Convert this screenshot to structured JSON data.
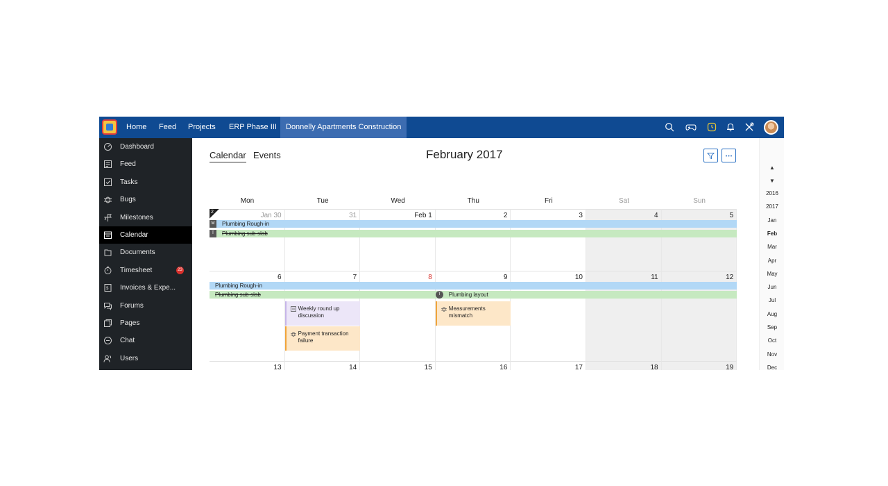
{
  "topbar": {
    "nav": [
      "Home",
      "Feed",
      "Projects",
      "ERP Phase III",
      "Donnelly Apartments Construction"
    ],
    "icons": [
      "search-icon",
      "gamepad-icon",
      "timer-icon",
      "bell-icon",
      "tools-icon"
    ],
    "accent": "#0f4a92"
  },
  "sidebar": {
    "items": [
      {
        "label": "Dashboard",
        "icon": "dashboard-icon"
      },
      {
        "label": "Feed",
        "icon": "feed-icon"
      },
      {
        "label": "Tasks",
        "icon": "tasks-icon"
      },
      {
        "label": "Bugs",
        "icon": "bug-icon"
      },
      {
        "label": "Milestones",
        "icon": "milestone-icon"
      },
      {
        "label": "Calendar",
        "icon": "calendar-icon",
        "active": true
      },
      {
        "label": "Documents",
        "icon": "documents-icon"
      },
      {
        "label": "Timesheet",
        "icon": "timer-icon",
        "badge": "23"
      },
      {
        "label": "Invoices & Expe...",
        "icon": "invoice-icon"
      },
      {
        "label": "Forums",
        "icon": "forums-icon"
      },
      {
        "label": "Pages",
        "icon": "pages-icon"
      },
      {
        "label": "Chat",
        "icon": "chat-icon"
      },
      {
        "label": "Users",
        "icon": "users-icon"
      }
    ]
  },
  "main": {
    "tabs": [
      "Calendar",
      "Events"
    ],
    "title": "February 2017",
    "weekdays": [
      "Mon",
      "Tue",
      "Wed",
      "Thu",
      "Fri",
      "Sat",
      "Sun"
    ],
    "week_marker": "2",
    "weeks": [
      {
        "days": [
          "Jan 30",
          "31",
          "Feb 1",
          "2",
          "3",
          "4",
          "5"
        ],
        "bars": [
          {
            "tag": "M",
            "label": "Plumbing Rough-in",
            "color": "blue",
            "strike": false
          },
          {
            "tag": "T",
            "label": "Plumbing sub-slab",
            "color": "green",
            "strike": true
          }
        ]
      },
      {
        "days": [
          "6",
          "7",
          "8",
          "9",
          "10",
          "11",
          "12"
        ],
        "bars": [
          {
            "label": "Plumbing Rough-in",
            "color": "blue"
          },
          {
            "label": "Plumbing sub-slab",
            "color": "green",
            "strike": true
          },
          {
            "tag": "T",
            "label": "Plumbing layout",
            "color": "green"
          }
        ],
        "cards": [
          {
            "label": "Weekly round up discussion",
            "icon": "meeting-icon",
            "color": "purple"
          },
          {
            "label": "Payment transaction failure",
            "icon": "bug-icon",
            "color": "orange"
          },
          {
            "label": "Measurements mismatch",
            "icon": "bug-icon",
            "color": "orange"
          }
        ]
      },
      {
        "days": [
          "13",
          "14",
          "15",
          "16",
          "17",
          "18",
          "19"
        ]
      }
    ]
  },
  "rail": {
    "years": [
      "2016",
      "2017"
    ],
    "months": [
      "Jan",
      "Feb",
      "Mar",
      "Apr",
      "May",
      "Jun",
      "Jul",
      "Aug",
      "Sep",
      "Oct",
      "Nov",
      "Dec"
    ],
    "active_month": "Feb"
  }
}
